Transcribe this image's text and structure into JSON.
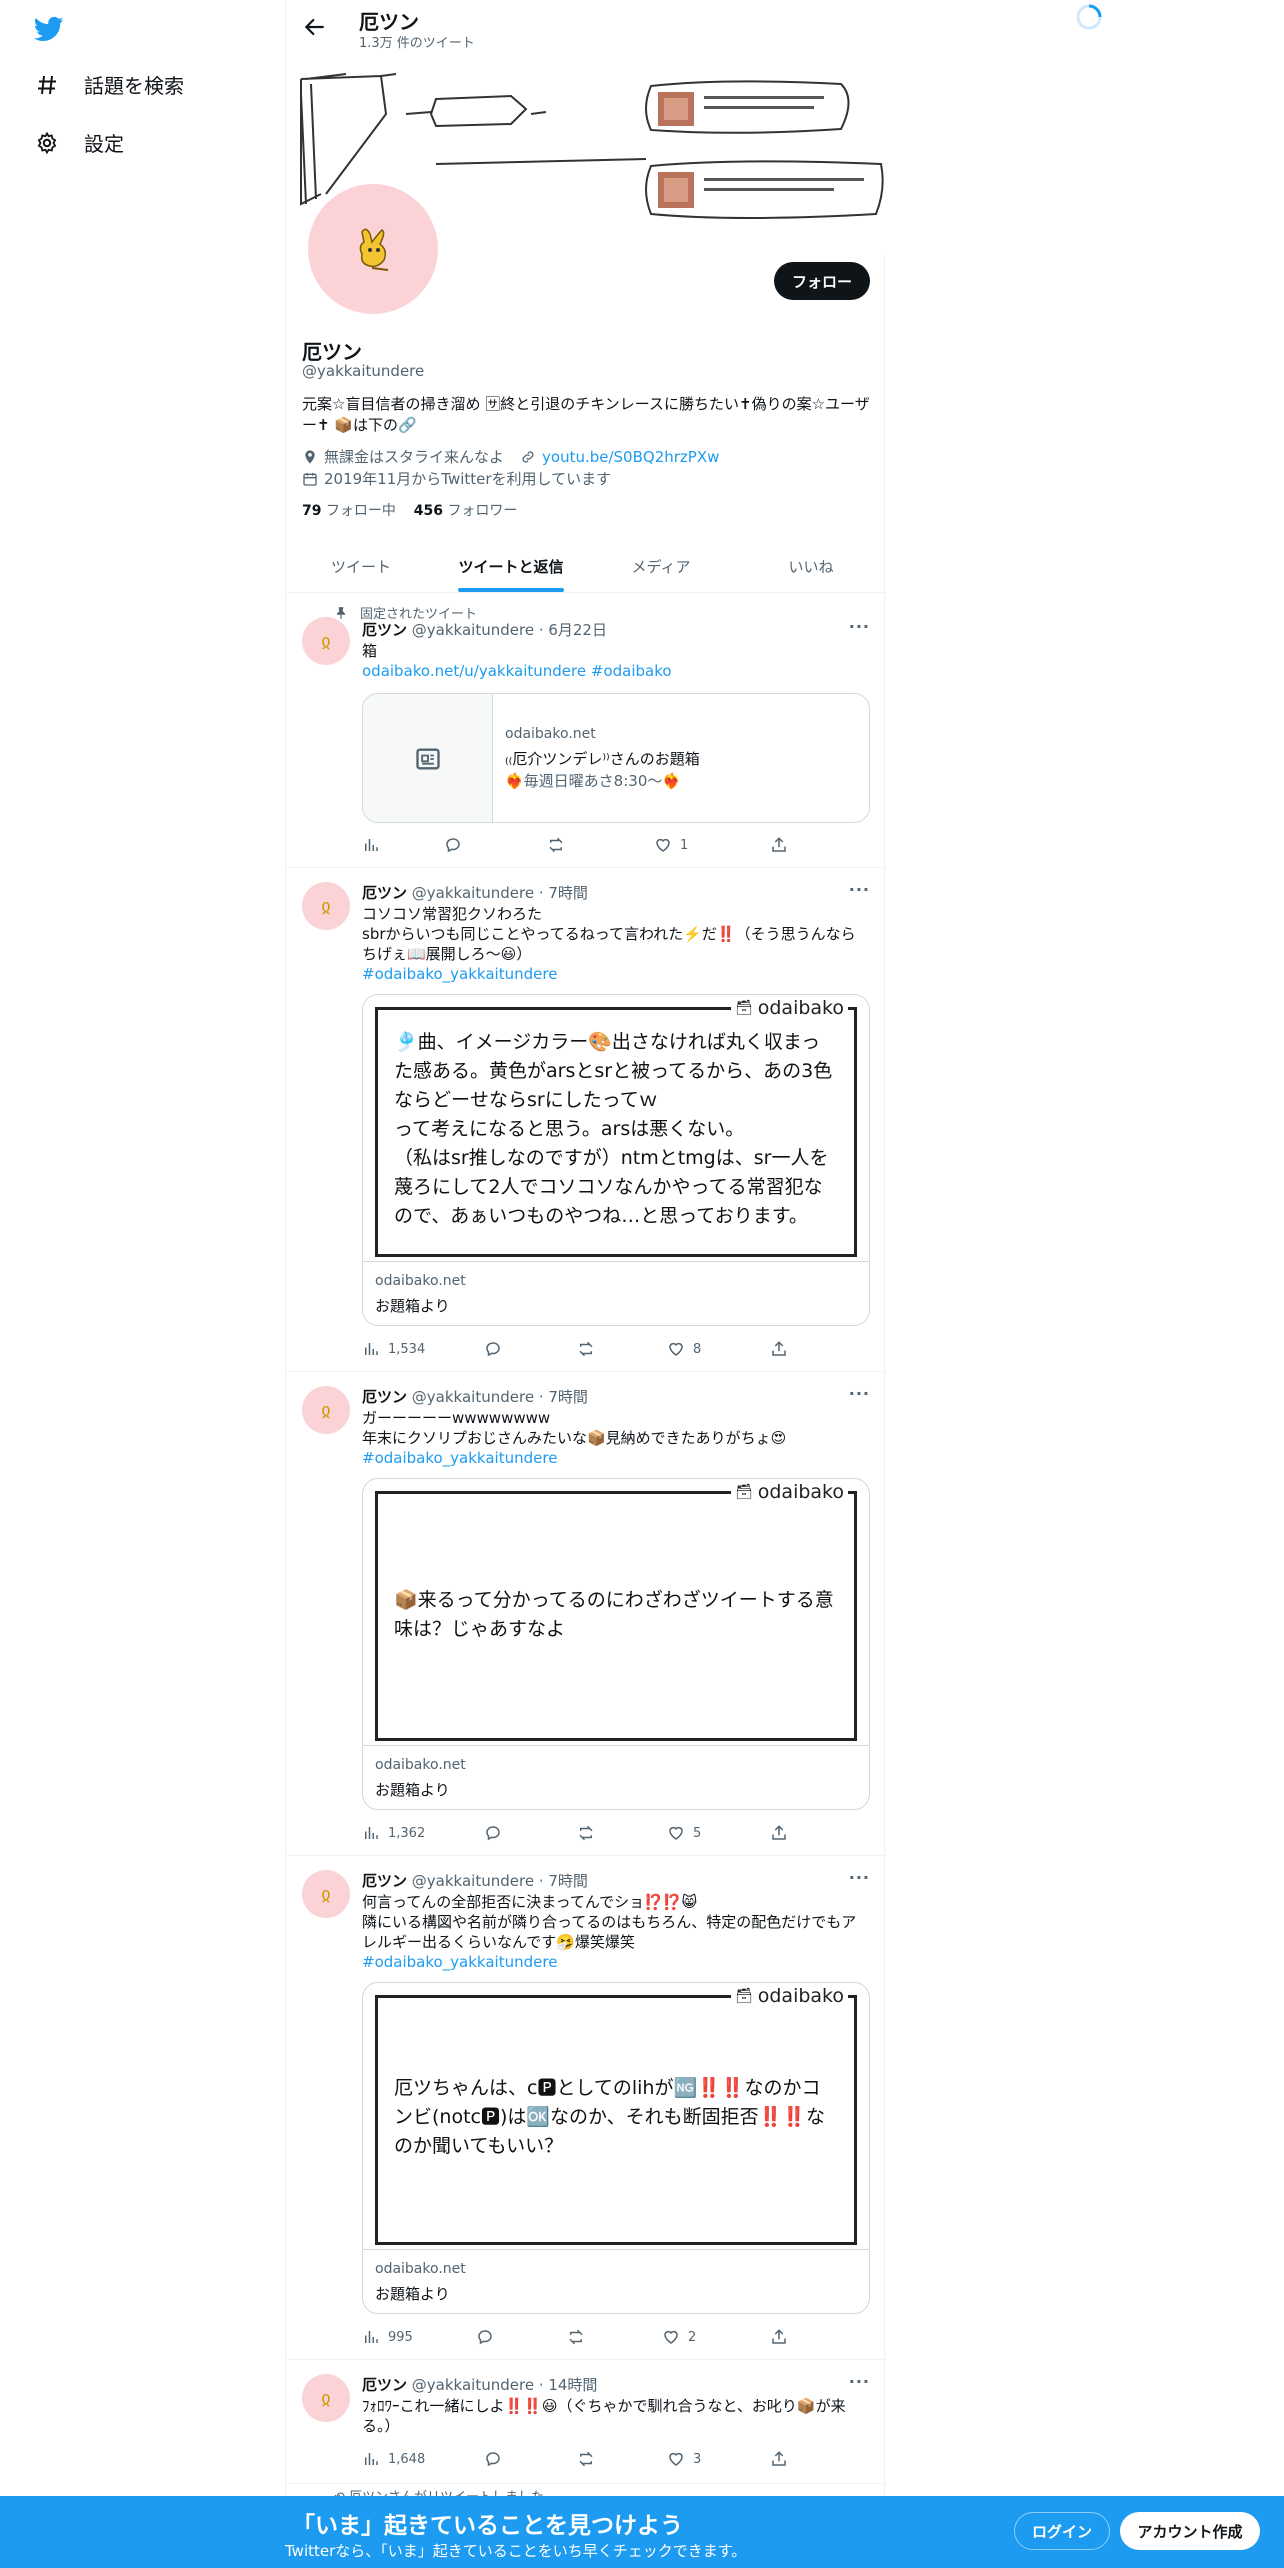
{
  "sidebar": {
    "explore_label": "話題を検索",
    "settings_label": "設定"
  },
  "header": {
    "title": "厄ツン",
    "tweet_count": "1.3万 件のツイート"
  },
  "profile": {
    "follow_label": "フォロー",
    "name": "厄ツン",
    "handle": "@yakkaitundere",
    "bio": "元案☆盲目信者の掃き溜め 🈂終と引退のチキンレースに勝ちたい✝偽りの案☆ユーザー✝ 📦は下の🔗",
    "location": "無課金はスタライ来んなよ",
    "link": "youtu.be/S0BQ2hrzPXw",
    "joined": "2019年11月からTwitterを利用しています",
    "following_count": "79",
    "following_label": "フォロー中",
    "followers_count": "456",
    "followers_label": "フォロワー"
  },
  "tabs": [
    "ツイート",
    "ツイートと返信",
    "メディア",
    "いいね"
  ],
  "tweets": [
    {
      "pinned_label": "固定されたツイート",
      "name": "厄ツン",
      "meta": "@yakkaitundere · 6月22日",
      "text": "箱",
      "link_text": "odaibako.net/u/yakkaitundere",
      "hashtag": "#odaibako",
      "card_domain": "odaibako.net",
      "card_title": "₍₍厄介ツンデレ⁾⁾さんのお題箱",
      "card_desc": "❤️‍🔥毎週日曜あさ8:30〜❤️‍🔥",
      "views": "",
      "likes": "1"
    },
    {
      "name": "厄ツン",
      "meta": "@yakkaitundere · 7時間",
      "text": "コソコソ常習犯クソわろた\nsbrからいつも同じことやってるねって言われた⚡️だ‼️（そう思うんならちげぇ📖展開しろ〜😃）",
      "hashtag": "#odaibako_yakkaitundere",
      "card_logo": "odaibako",
      "card_body": "🎐曲、イメージカラー🎨出さなければ丸く収まった感ある。黄色がarsとsrと被ってるから、あの3色ならどーせならsrにしたってｗ\nって考えになると思う。arsは悪くない。\n（私はsr推しなのですが）ntmとtmgは、sr一人を蔑ろにして2人でコソコソなんかやってる常習犯なので、あぁいつものやつね…と思っております。",
      "card_domain": "odaibako.net",
      "card_from": "お題箱より",
      "views": "1,534",
      "likes": "8"
    },
    {
      "name": "厄ツン",
      "meta": "@yakkaitundere · 7時間",
      "text": "ガーーーーーwwwwwwww\n年末にクソリプおじさんみたいな📦見納めできたありがちょ😍",
      "hashtag": "#odaibako_yakkaitundere",
      "card_logo": "odaibako",
      "card_body": "📦来るって分かってるのにわざわざツイートする意味は？じゃあすなよ",
      "card_domain": "odaibako.net",
      "card_from": "お題箱より",
      "views": "1,362",
      "likes": "5"
    },
    {
      "name": "厄ツン",
      "meta": "@yakkaitundere · 7時間",
      "text": "何言ってんの全部拒否に決まってんでショ⁉️⁉️😸\n隣にいる構図や名前が隣り合ってるのはもちろん、特定の配色だけでもアレルギー出るくらいなんです🤧爆笑爆笑",
      "hashtag": "#odaibako_yakkaitundere",
      "card_logo": "odaibako",
      "card_body": "厄ツちゃんは、c🅿としてのlihが🆖‼️‼️なのかコンビ(notc🅿)は🆗なのか、それも断固拒否‼️‼️なのか聞いてもいい？",
      "card_domain": "odaibako.net",
      "card_from": "お題箱より",
      "views": "995",
      "likes": "2"
    },
    {
      "name": "厄ツン",
      "meta": "@yakkaitundere · 14時間",
      "text": "ﾌｫﾛﾜｰこれ一緒にしよ‼️‼️😃（ぐちゃかで馴れ合うなと、お叱り📦が来る。）",
      "views": "1,648",
      "likes": "3"
    }
  ],
  "retweet_notice": "厄ツンさんがリツイートしました",
  "bottom_bar": {
    "title": "「いま」起きていることを見つけよう",
    "subtitle": "Twitterなら、「いま」起きていることをいち早くチェックできます。",
    "login_label": "ログイン",
    "signup_label": "アカウント作成"
  },
  "colors": {
    "accent": "#1d9bf0",
    "text": "#0f1419",
    "muted": "#536471",
    "avatar_bg": "#fbd3d7"
  }
}
